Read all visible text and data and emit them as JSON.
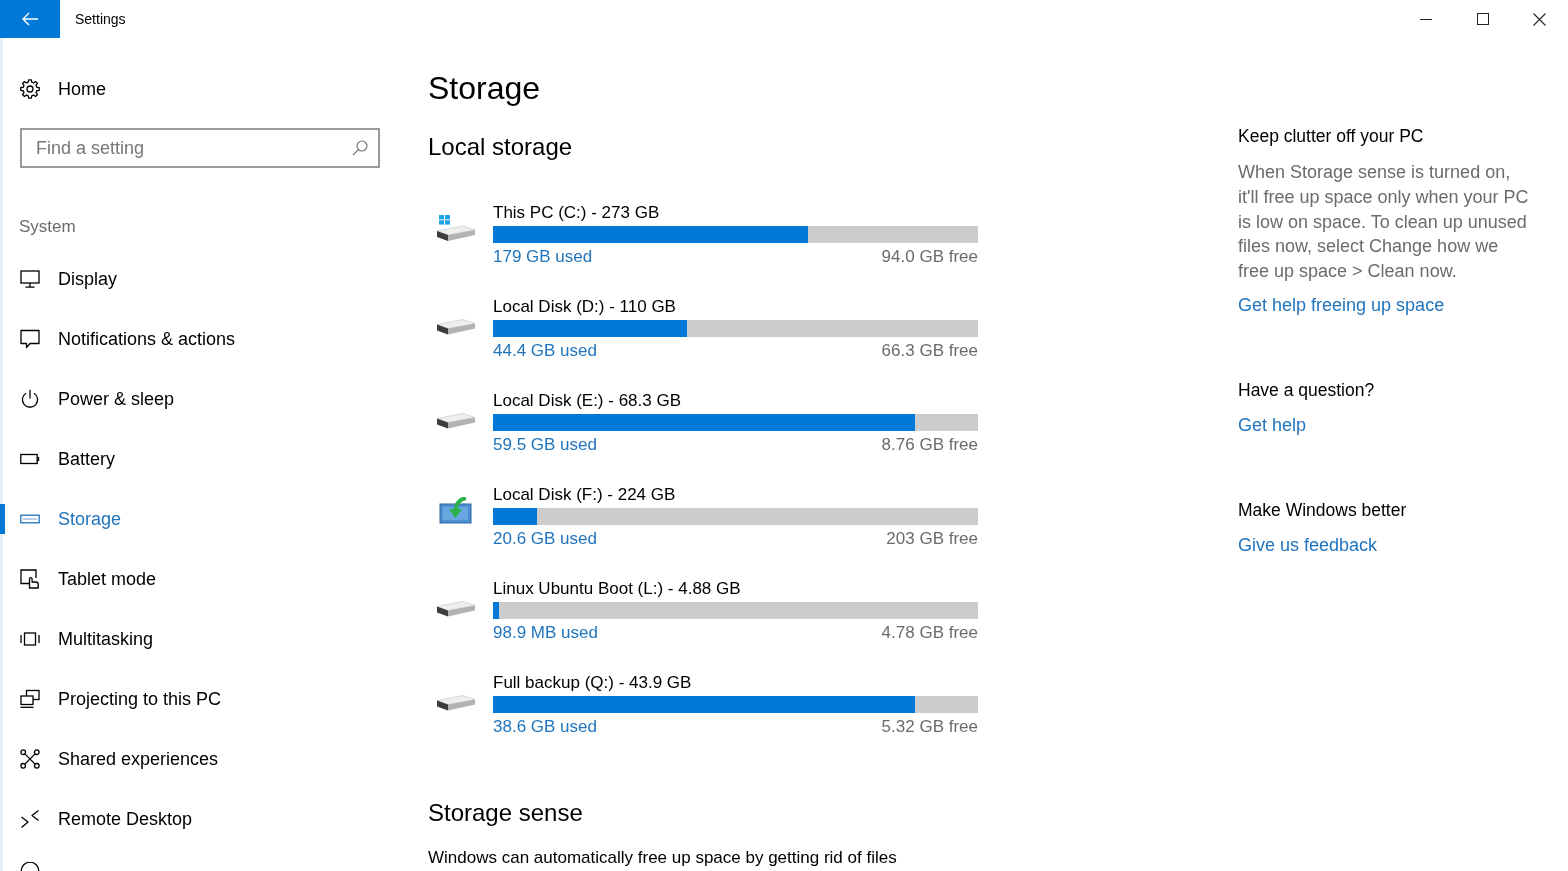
{
  "window": {
    "title": "Settings"
  },
  "sidebar": {
    "home": "Home",
    "search": {
      "placeholder": "Find a setting"
    },
    "group": "System",
    "items": [
      {
        "label": "Display",
        "selected": false
      },
      {
        "label": "Notifications & actions",
        "selected": false
      },
      {
        "label": "Power & sleep",
        "selected": false
      },
      {
        "label": "Battery",
        "selected": false
      },
      {
        "label": "Storage",
        "selected": true
      },
      {
        "label": "Tablet mode",
        "selected": false
      },
      {
        "label": "Multitasking",
        "selected": false
      },
      {
        "label": "Projecting to this PC",
        "selected": false
      },
      {
        "label": "Shared experiences",
        "selected": false
      },
      {
        "label": "Remote Desktop",
        "selected": false
      }
    ]
  },
  "page": {
    "title": "Storage",
    "section": "Local storage",
    "drives": [
      {
        "kind": "system",
        "name": "This PC (C:) - 273 GB",
        "level": 0.65,
        "used": "179 GB used",
        "free": "94.0 GB free"
      },
      {
        "kind": "plain",
        "name": "Local Disk (D:) - 110 GB",
        "level": 0.4,
        "used": "44.4 GB used",
        "free": "66.3 GB free"
      },
      {
        "kind": "plain",
        "name": "Local Disk (E:) - 68.3 GB",
        "level": 0.87,
        "used": "59.5 GB used",
        "free": "8.76 GB free"
      },
      {
        "kind": "custom",
        "name": "Local Disk (F:) - 224 GB",
        "level": 0.09,
        "used": "20.6 GB used",
        "free": "203 GB free"
      },
      {
        "kind": "plain",
        "name": "Linux Ubuntu Boot (L:) - 4.88 GB",
        "level": 0.012,
        "used": "98.9 MB used",
        "free": "4.78 GB free"
      },
      {
        "kind": "plain",
        "name": "Full backup (Q:) - 43.9 GB",
        "level": 0.87,
        "used": "38.6 GB used",
        "free": "5.32 GB free"
      }
    ],
    "storage_sense": {
      "title": "Storage sense",
      "text": "Windows can automatically free up space by getting rid of files"
    }
  },
  "help_panel": {
    "sections": [
      {
        "heading": "Keep clutter off your PC",
        "text": "When Storage sense is turned on, it'll free up space only when your PC is low on space. To clean up unused files now, select Change how we free up space > Clean now.",
        "link": "Get help freeing up space"
      },
      {
        "heading": "Have a question?",
        "link": "Get help"
      },
      {
        "heading": "Make Windows better",
        "link": "Give us feedback"
      }
    ]
  }
}
